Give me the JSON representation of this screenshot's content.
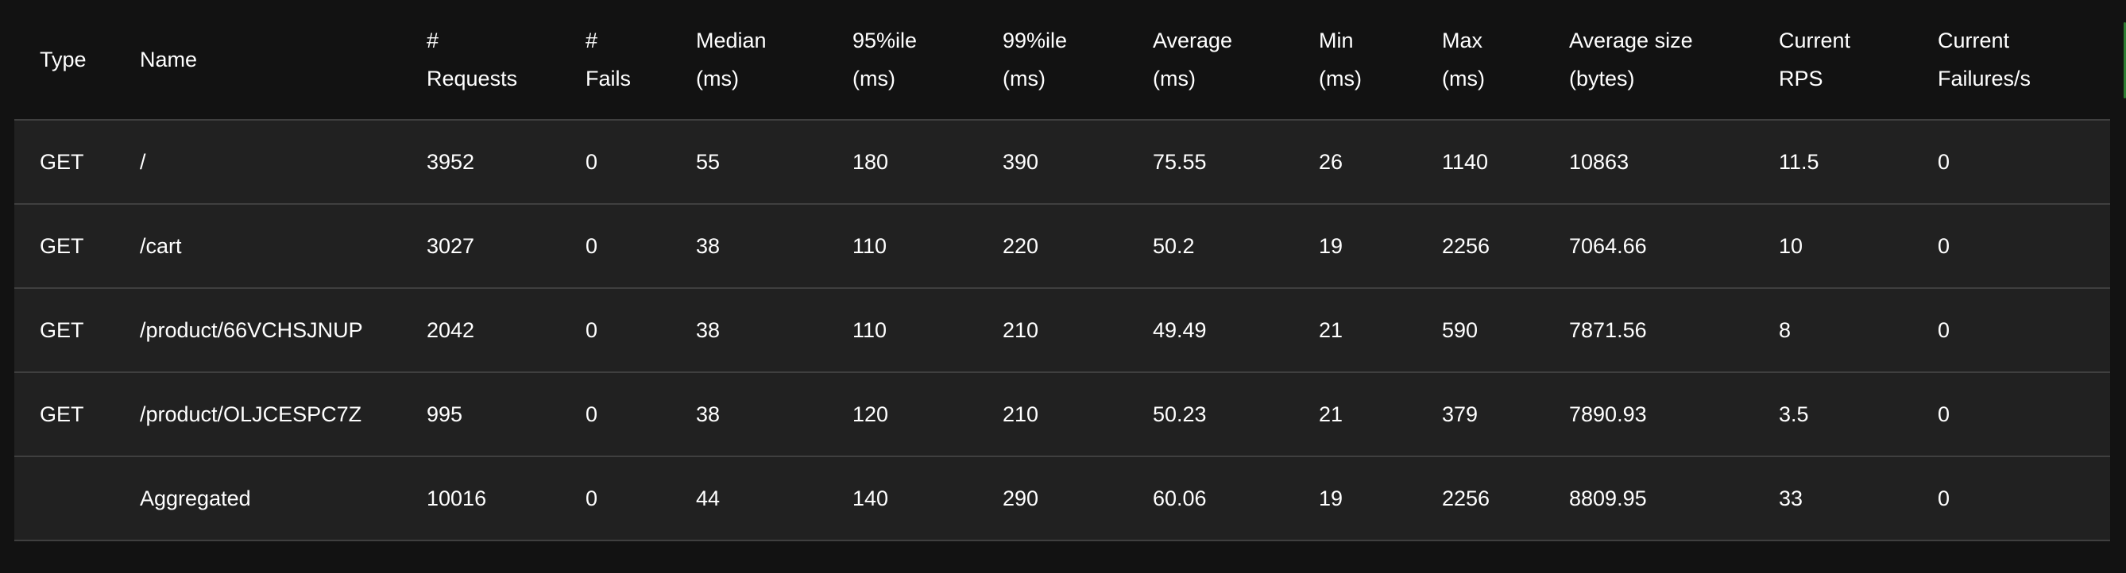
{
  "columns": [
    {
      "key": "type",
      "lines": [
        "Type"
      ]
    },
    {
      "key": "name",
      "lines": [
        "Name"
      ]
    },
    {
      "key": "requests",
      "lines": [
        "#",
        "Requests"
      ]
    },
    {
      "key": "fails",
      "lines": [
        "#",
        "Fails"
      ]
    },
    {
      "key": "median",
      "lines": [
        "Median",
        "(ms)"
      ]
    },
    {
      "key": "p95",
      "lines": [
        "95%ile",
        "(ms)"
      ]
    },
    {
      "key": "p99",
      "lines": [
        "99%ile",
        "(ms)"
      ]
    },
    {
      "key": "average",
      "lines": [
        "Average",
        "(ms)"
      ]
    },
    {
      "key": "min",
      "lines": [
        "Min",
        "(ms)"
      ]
    },
    {
      "key": "max",
      "lines": [
        "Max",
        "(ms)"
      ]
    },
    {
      "key": "avg_size",
      "lines": [
        "Average size",
        "(bytes)"
      ]
    },
    {
      "key": "rps",
      "lines": [
        "Current",
        "RPS"
      ]
    },
    {
      "key": "failures_per_s",
      "lines": [
        "Current",
        "Failures/s"
      ]
    }
  ],
  "rows": [
    {
      "type": "GET",
      "name": "/",
      "requests": "3952",
      "fails": "0",
      "median": "55",
      "p95": "180",
      "p99": "390",
      "average": "75.55",
      "min": "26",
      "max": "1140",
      "avg_size": "10863",
      "rps": "11.5",
      "failures_per_s": "0"
    },
    {
      "type": "GET",
      "name": "/cart",
      "requests": "3027",
      "fails": "0",
      "median": "38",
      "p95": "110",
      "p99": "220",
      "average": "50.2",
      "min": "19",
      "max": "2256",
      "avg_size": "7064.66",
      "rps": "10",
      "failures_per_s": "0"
    },
    {
      "type": "GET",
      "name": "/product/66VCHSJNUP",
      "requests": "2042",
      "fails": "0",
      "median": "38",
      "p95": "110",
      "p99": "210",
      "average": "49.49",
      "min": "21",
      "max": "590",
      "avg_size": "7871.56",
      "rps": "8",
      "failures_per_s": "0"
    },
    {
      "type": "GET",
      "name": "/product/OLJCESPC7Z",
      "requests": "995",
      "fails": "0",
      "median": "38",
      "p95": "120",
      "p99": "210",
      "average": "50.23",
      "min": "21",
      "max": "379",
      "avg_size": "7890.93",
      "rps": "3.5",
      "failures_per_s": "0"
    },
    {
      "type": "",
      "name": "Aggregated",
      "requests": "10016",
      "fails": "0",
      "median": "44",
      "p95": "140",
      "p99": "290",
      "average": "60.06",
      "min": "19",
      "max": "2256",
      "avg_size": "8809.95",
      "rps": "33",
      "failures_per_s": "0"
    }
  ],
  "colors": {
    "background": "#121212",
    "row_background": "#212121",
    "divider": "#3f3f3f",
    "text": "#ffffff",
    "edge_accent": "#2e7d32"
  }
}
